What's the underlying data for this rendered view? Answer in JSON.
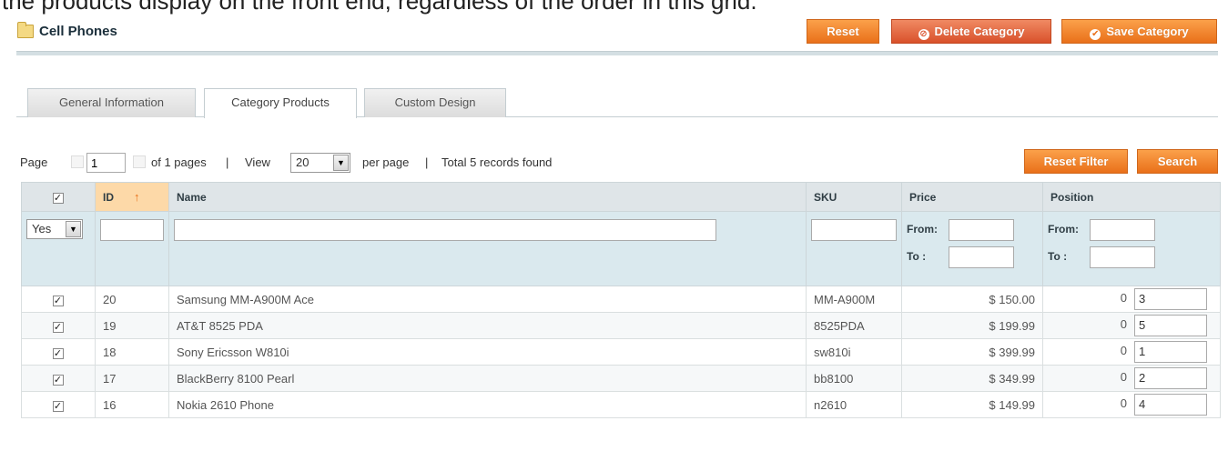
{
  "caption": "the products display on the front end, regardless of the order in this grid.",
  "header": {
    "title": "Cell Phones",
    "reset_label": "Reset",
    "delete_label": "Delete Category",
    "save_label": "Save Category"
  },
  "tabs": [
    {
      "label": "General Information",
      "active": false
    },
    {
      "label": "Category Products",
      "active": true
    },
    {
      "label": "Custom Design",
      "active": false
    }
  ],
  "pager": {
    "page_label": "Page",
    "page_value": "1",
    "of_pages": "of 1 pages",
    "sep1": "|",
    "view_label": "View",
    "per_page_value": "20",
    "per_page_label": "per page",
    "sep2": "|",
    "total": "Total 5 records found",
    "reset_filter_label": "Reset Filter",
    "search_label": "Search"
  },
  "grid": {
    "columns": {
      "id": "ID",
      "name": "Name",
      "sku": "SKU",
      "price": "Price",
      "position": "Position"
    },
    "filter": {
      "in_category_value": "Yes",
      "from_label": "From:",
      "to_label": "To :"
    },
    "rows": [
      {
        "id": "20",
        "name": "Samsung MM-A900M Ace",
        "sku": "MM-A900M",
        "price": "$ 150.00",
        "pos_zero": "0",
        "position": "3"
      },
      {
        "id": "19",
        "name": "AT&T 8525 PDA",
        "sku": "8525PDA",
        "price": "$ 199.99",
        "pos_zero": "0",
        "position": "5"
      },
      {
        "id": "18",
        "name": "Sony Ericsson W810i",
        "sku": "sw810i",
        "price": "$ 399.99",
        "pos_zero": "0",
        "position": "1"
      },
      {
        "id": "17",
        "name": "BlackBerry 8100 Pearl",
        "sku": "bb8100",
        "price": "$ 349.99",
        "pos_zero": "0",
        "position": "2"
      },
      {
        "id": "16",
        "name": "Nokia 2610 Phone",
        "sku": "n2610",
        "price": "$ 149.99",
        "pos_zero": "0",
        "position": "4"
      }
    ]
  }
}
